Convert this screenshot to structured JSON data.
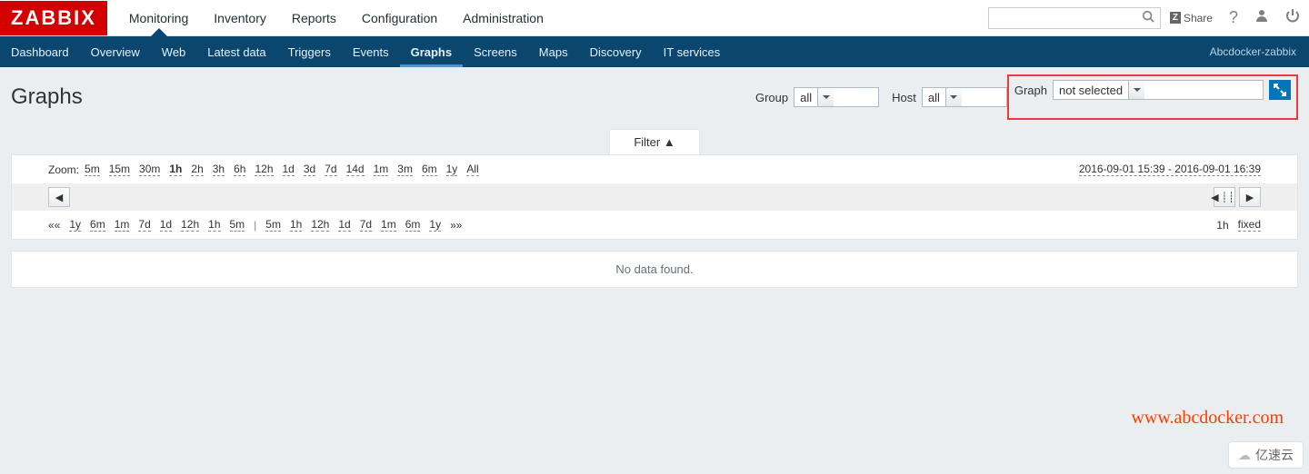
{
  "logo": "ZABBIX",
  "topnav": {
    "items": [
      "Monitoring",
      "Inventory",
      "Reports",
      "Configuration",
      "Administration"
    ],
    "active_index": 0
  },
  "search": {
    "placeholder": ""
  },
  "share_label": "Share",
  "subnav": {
    "items": [
      "Dashboard",
      "Overview",
      "Web",
      "Latest data",
      "Triggers",
      "Events",
      "Graphs",
      "Screens",
      "Maps",
      "Discovery",
      "IT services"
    ],
    "active_index": 6,
    "user_label": "Abcdocker-zabbix"
  },
  "page_title": "Graphs",
  "filters": {
    "group": {
      "label": "Group",
      "value": "all"
    },
    "host": {
      "label": "Host",
      "value": "all"
    },
    "graph": {
      "label": "Graph",
      "value": "not selected"
    }
  },
  "filter_toggle": "Filter ▲",
  "zoom": {
    "label": "Zoom:",
    "links": [
      "5m",
      "15m",
      "30m",
      "1h",
      "2h",
      "3h",
      "6h",
      "12h",
      "1d",
      "3d",
      "7d",
      "14d",
      "1m",
      "3m",
      "6m",
      "1y",
      "All"
    ],
    "current": "1h",
    "date_range": "2016-09-01 15:39 - 2016-09-01 16:39"
  },
  "shift": {
    "left_links": [
      "1y",
      "6m",
      "1m",
      "7d",
      "1d",
      "12h",
      "1h",
      "5m"
    ],
    "right_links": [
      "5m",
      "1h",
      "12h",
      "1d",
      "7d",
      "1m",
      "6m",
      "1y"
    ],
    "left_sym": "««",
    "right_sym": "»»",
    "sep": "|",
    "duration": "1h",
    "mode": "fixed"
  },
  "no_data": "No data found.",
  "watermark": "www.abcdocker.com",
  "corner_badge": "亿速云"
}
